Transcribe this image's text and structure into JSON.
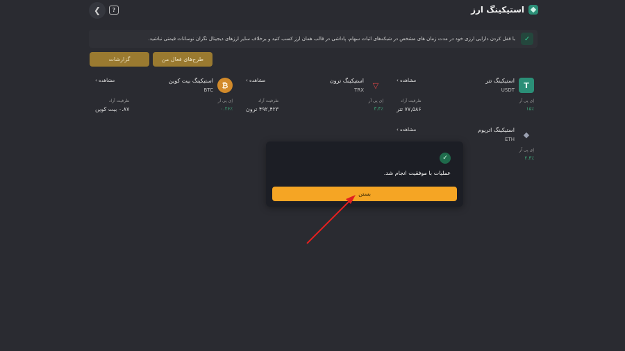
{
  "header": {
    "title": "استیکینگ ارز",
    "help_glyph": "?"
  },
  "notice": {
    "text": "با قفل کردن دارایی ارزی خود در مدت زمان های مشخص در شبکه‌های اثبات سهام، پاداشی در قالب همان ارز کسب کنید و برخلاف سایر ارزهای دیجیتال نگران نوسانات قیمتی نباشید."
  },
  "buttons": {
    "reports": "گزارشات",
    "my_plans": "طرح‌های فعال من"
  },
  "cards": [
    {
      "name": "استیکینگ تتر",
      "symbol": "USDT",
      "view": "مشاهده",
      "apr_label": "اِی پی آر",
      "apr": "۱۵٪",
      "cap_label": "ظرفیت آزاد",
      "cap": "۷۷,۵۸۶ تتر"
    },
    {
      "name": "استیکینگ ترون",
      "symbol": "TRX",
      "view": "مشاهده",
      "apr_label": "اِی پی آر",
      "apr": "۳.۴٪",
      "cap_label": "ظرفیت آزاد",
      "cap": "۴۹۲,۴۲۳ ترون"
    },
    {
      "name": "استیکینگ بیت کوین",
      "symbol": "BTC",
      "view": "مشاهده",
      "apr_label": "اِی پی آر",
      "apr": "۰.۲۶٪",
      "cap_label": "ظرفیت آزاد",
      "cap": "۰.۸۷ بیت کوین"
    },
    {
      "name": "استیکینگ اتریوم",
      "symbol": "ETH",
      "view": "مشاهده",
      "apr_label": "اِی پی آر",
      "apr": "۲.۴٪"
    }
  ],
  "modal": {
    "message": "عملیات با موفقیت انجام شد.",
    "close_label": "بستن"
  },
  "colors": {
    "accent": "#f5a524",
    "success": "#3fb07e",
    "background": "#2a2b31"
  }
}
